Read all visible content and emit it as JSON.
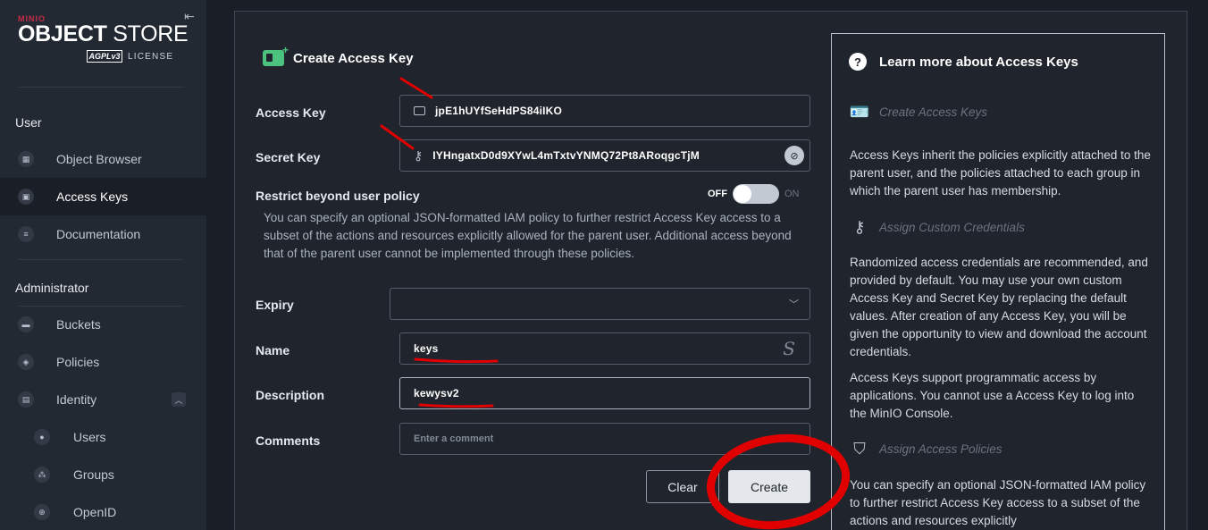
{
  "sidebar": {
    "brand": "MINIO",
    "product_bold": "OBJECT",
    "product_light": "STORE",
    "license_badge": "AGPLv3",
    "license_text": "LICENSE",
    "collapse_icon": "collapse-left-icon",
    "user_section": "User",
    "admin_section": "Administrator",
    "user_items": [
      {
        "label": "Object Browser",
        "icon": "object-browser-icon"
      },
      {
        "label": "Access Keys",
        "icon": "access-keys-icon",
        "active": true
      },
      {
        "label": "Documentation",
        "icon": "documentation-icon"
      }
    ],
    "admin_items": [
      {
        "label": "Buckets",
        "icon": "buckets-icon"
      },
      {
        "label": "Policies",
        "icon": "policies-icon"
      },
      {
        "label": "Identity",
        "icon": "identity-icon",
        "expanded": true
      }
    ],
    "identity_items": [
      {
        "label": "Users",
        "icon": "users-icon"
      },
      {
        "label": "Groups",
        "icon": "groups-icon"
      },
      {
        "label": "OpenID",
        "icon": "openid-icon"
      }
    ]
  },
  "form": {
    "title": "Create Access Key",
    "access_key_label": "Access Key",
    "access_key_value": "jpE1hUYfSeHdPS84iIKO",
    "secret_key_label": "Secret Key",
    "secret_key_value": "IYHngatxD0d9XYwL4mTxtvYNMQ72Pt8ARoqgcTjM",
    "restrict_label": "Restrict beyond user policy",
    "toggle_off": "OFF",
    "toggle_on": "ON",
    "restrict_desc": "You can specify an optional JSON-formatted IAM policy to further restrict Access Key access to a subset of the actions and resources explicitly allowed for the parent user. Additional access beyond that of the parent user cannot be implemented through these policies.",
    "expiry_label": "Expiry",
    "expiry_value": "",
    "name_label": "Name",
    "name_value": "keys",
    "description_label": "Description",
    "description_value": "kewysv2",
    "comments_label": "Comments",
    "comments_placeholder": "Enter a comment",
    "clear_button": "Clear",
    "create_button": "Create"
  },
  "help": {
    "title": "Learn more about Access Keys",
    "sections": [
      {
        "heading": "Create Access Keys",
        "icon": "id-card-icon"
      },
      {
        "heading": "Assign Custom Credentials",
        "icon": "key-icon"
      },
      {
        "heading": "Assign Access Policies",
        "icon": "shield-icon"
      }
    ],
    "p1": "Access Keys inherit the policies explicitly attached to the parent user, and the policies attached to each group in which the parent user has membership.",
    "p2": "Randomized access credentials are recommended, and provided by default. You may use your own custom Access Key and Secret Key by replacing the default values. After creation of any Access Key, you will be given the opportunity to view and download the account credentials.",
    "p3": "Access Keys support programmatic access by applications. You cannot use a Access Key to log into the MinIO Console.",
    "p4": "You can specify an optional JSON-formatted IAM policy to further restrict Access Key access to a subset of the actions and resources explicitly"
  },
  "colors": {
    "annotation": "#e00000",
    "sidebar_bg": "#232933",
    "main_bg": "#1a1e26",
    "brand": "#c72c48",
    "title_icon": "#4cc27f"
  }
}
